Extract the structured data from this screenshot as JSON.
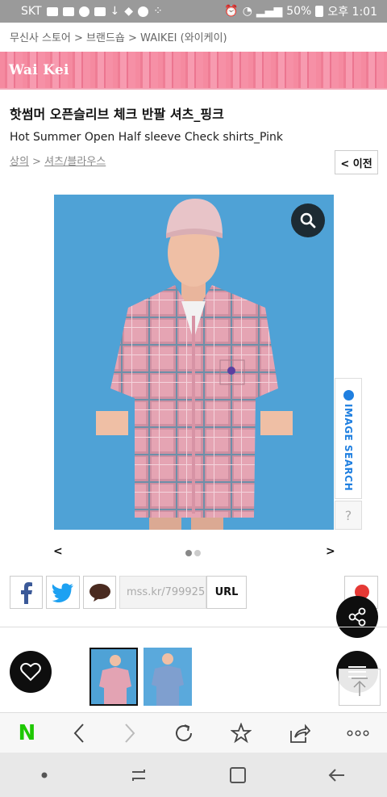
{
  "status_bar": {
    "carrier": "SKT",
    "battery": "50%",
    "time": "오후 1:01"
  },
  "breadcrumb": "무신사 스토어 > 브랜드숍 > WAIKEI (와이케이)",
  "brand": {
    "logo_text": "Wai Kei",
    "banner_color": "#f58aa0"
  },
  "product": {
    "title_ko": "핫썸머 오픈슬리브 체크 반팔 셔츠_핑크",
    "title_en": "Hot Summer Open Half sleeve Check shirts_Pink",
    "category_top": "상의",
    "category_sep": " > ",
    "category_sub": "셔츠/블라우스",
    "prev_label": "< 이전",
    "photo_bg": "#4fa2d6"
  },
  "image_search": {
    "label": "IMAGE SEARCH",
    "help": "?"
  },
  "gallery": {
    "prev": "<",
    "next": ">",
    "active_index": 0,
    "count": 2
  },
  "share": {
    "url_text": "mss.kr/799925",
    "url_button": "URL"
  },
  "colors": {
    "accent_blue": "#1f7fe0",
    "naver_green": "#1ec800",
    "fab_black": "#0e0e0e"
  }
}
